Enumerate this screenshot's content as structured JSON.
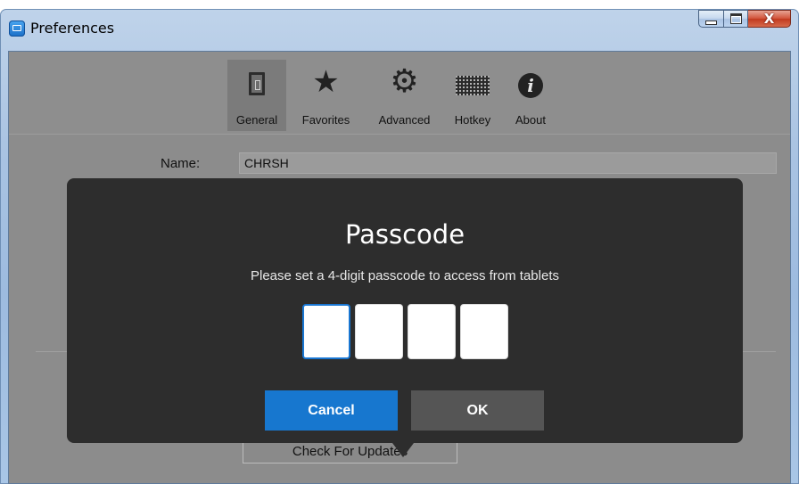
{
  "window": {
    "title": "Preferences",
    "close_glyph": "X"
  },
  "toolbar": {
    "items": [
      {
        "label": "General",
        "icon": "general-icon",
        "selected": true
      },
      {
        "label": "Favorites",
        "icon": "star-icon"
      },
      {
        "label": "Advanced",
        "icon": "gear-icon"
      },
      {
        "label": "Hotkey",
        "icon": "keyboard-icon"
      },
      {
        "label": "About",
        "icon": "info-icon"
      }
    ]
  },
  "general": {
    "name_label": "Name:",
    "name_value": "CHRSH",
    "update_button": "Check For Updates"
  },
  "dialog": {
    "title": "Passcode",
    "message": "Please set a 4-digit passcode to access from tablets",
    "cancel_label": "Cancel",
    "ok_label": "OK",
    "digits": [
      "",
      "",
      "",
      ""
    ]
  },
  "colors": {
    "accent": "#1777cf",
    "dialog_bg": "#2d2d2d",
    "client_bg": "#8c8c8c"
  }
}
